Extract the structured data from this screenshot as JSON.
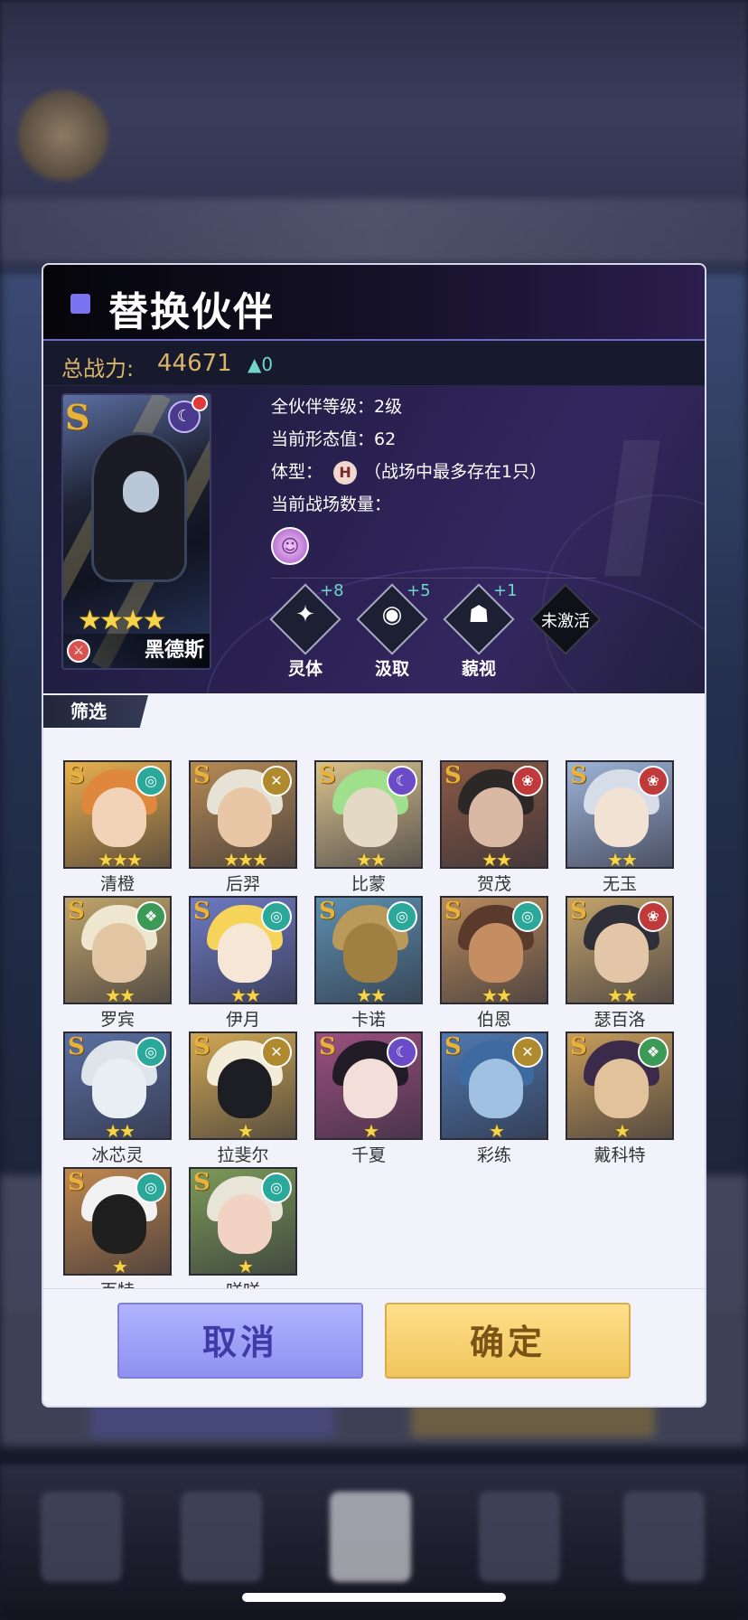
{
  "dialog": {
    "title": "替换伙伴",
    "power_label": "总战力:",
    "power_value": "44671",
    "power_change": "▲0",
    "filter_label": "筛选",
    "cancel_label": "取消",
    "confirm_label": "确定"
  },
  "current_partner": {
    "grade": "S",
    "name": "黑德斯",
    "stars": "★★★★",
    "star_count": 4,
    "element_icon": "moon-icon",
    "weapon_icon": "sword-icon"
  },
  "stats": {
    "level": "全伙伴等级：2级",
    "form": "当前形态值：62",
    "body_label": "体型：",
    "body_badge": "H",
    "body_note": "（战场中最多存在1只）",
    "count_label": "当前战场数量："
  },
  "skills": [
    {
      "label": "灵体",
      "plus": "+8",
      "glyph": "✦"
    },
    {
      "label": "汲取",
      "plus": "+5",
      "glyph": "◉"
    },
    {
      "label": "藐视",
      "plus": "+1",
      "glyph": "☗"
    },
    {
      "label": "",
      "plus": "",
      "glyph": "未激活"
    }
  ],
  "partners": [
    {
      "name": "清橙",
      "stars": "★★★",
      "elem": "wind",
      "hair": "#e0873e",
      "face": "#f2d3b7",
      "bg": "#e8b04f"
    },
    {
      "name": "后羿",
      "stars": "★★★",
      "elem": "gold",
      "hair": "#e7e2d6",
      "face": "#e9c6a6",
      "bg": "#b68a54"
    },
    {
      "name": "比蒙",
      "stars": "★★",
      "elem": "moon",
      "hair": "#9ee08c",
      "face": "#e3d9c4",
      "bg": "#d9c28d"
    },
    {
      "name": "贺茂",
      "stars": "★★",
      "elem": "fire",
      "hair": "#2c2828",
      "face": "#d9b8a4",
      "bg": "#8a5a44"
    },
    {
      "name": "无玉",
      "stars": "★★",
      "elem": "fire",
      "hair": "#d6dde8",
      "face": "#f1e2d4",
      "bg": "#9db3d8"
    },
    {
      "name": "罗宾",
      "stars": "★★",
      "elem": "leaf",
      "hair": "#efe6cf",
      "face": "#e2c6a4",
      "bg": "#c0a46a"
    },
    {
      "name": "伊月",
      "stars": "★★",
      "elem": "wind",
      "hair": "#f6d45a",
      "face": "#f6e6d6",
      "bg": "#6e7ac2"
    },
    {
      "name": "卡诺",
      "stars": "★★",
      "elem": "wind",
      "hair": "#b99a5a",
      "face": "#a08042",
      "bg": "#5c8fb0"
    },
    {
      "name": "伯恩",
      "stars": "★★",
      "elem": "wind",
      "hair": "#5a3a2a",
      "face": "#c58e62",
      "bg": "#b88b5c"
    },
    {
      "name": "瑟百洛",
      "stars": "★★",
      "elem": "fire",
      "hair": "#2f2f3a",
      "face": "#e3c6a8",
      "bg": "#c3a36c"
    },
    {
      "name": "冰芯灵",
      "stars": "★★",
      "elem": "wind",
      "hair": "#dfe3ea",
      "face": "#e9eef4",
      "bg": "#5a6fa2"
    },
    {
      "name": "拉斐尔",
      "stars": "★",
      "elem": "gold",
      "hair": "#f3ecd8",
      "face": "#1d1d24",
      "bg": "#d0a855"
    },
    {
      "name": "千夏",
      "stars": "★",
      "elem": "moon",
      "hair": "#221c26",
      "face": "#f2dfd9",
      "bg": "#9c4f7f"
    },
    {
      "name": "彩练",
      "stars": "★",
      "elem": "gold",
      "hair": "#3d6aa0",
      "face": "#9fc0e0",
      "bg": "#4f78b0"
    },
    {
      "name": "戴科特",
      "stars": "★",
      "elem": "leaf",
      "hair": "#3b2a4a",
      "face": "#e2c29a",
      "bg": "#c69c5a"
    },
    {
      "name": "百特",
      "stars": "★",
      "elem": "wind",
      "hair": "#f2f2f2",
      "face": "#1f1f1f",
      "bg": "#c0884f"
    },
    {
      "name": "咩咩",
      "stars": "★",
      "elem": "wind",
      "hair": "#e9e4d8",
      "face": "#f2d2c2",
      "bg": "#7c9a58"
    }
  ],
  "element_colors": {
    "wind": "#2aa89a",
    "gold": "#b08a2e",
    "moon": "#6b4bc8",
    "fire": "#c0393b",
    "leaf": "#3a9a56"
  },
  "element_glyphs": {
    "wind": "◎",
    "gold": "✕",
    "moon": "☾",
    "fire": "❀",
    "leaf": "❖"
  }
}
